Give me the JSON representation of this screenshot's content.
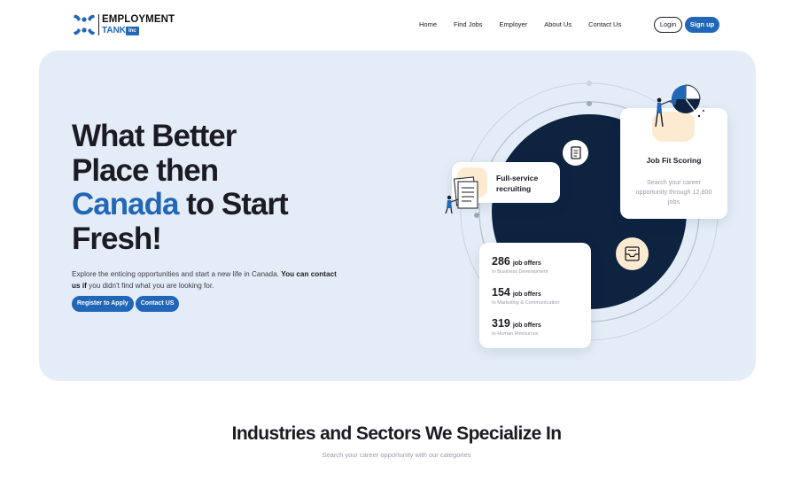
{
  "brand": {
    "name_line1": "EMPLOYMENT",
    "name_line2": "TANK",
    "badge": "Inc",
    "accent": "#2266b8",
    "dark": "#0d2340",
    "hero_bg": "#e4edf7",
    "peach": "#fcebd0"
  },
  "nav": {
    "items": [
      "Home",
      "Find Jobs",
      "Employer",
      "About Us",
      "Contact Us"
    ],
    "login_label": "Login",
    "signup_label": "Sign up"
  },
  "hero": {
    "title_line1": "What Better",
    "title_line2": "Place then",
    "title_highlight": "Canada",
    "title_line3_rest": " to Start",
    "title_line4": "Fresh!",
    "desc_plain": "Explore the enticing opportunities and start a new life in Canada. ",
    "desc_bold": "You can contact us if",
    "desc_rest": " you didn't find what you are looking for.",
    "register_label": "Register to Apply",
    "contact_label": "Contact US"
  },
  "illustration": {
    "full_service_label": "Full-service recruiting",
    "job_fit_title": "Job Fit Scoring",
    "job_fit_desc": "Search your career opportunity through 12,800 jobs",
    "jobs": [
      {
        "count": "286",
        "unit": "job offers",
        "category": "In Business Development"
      },
      {
        "count": "154",
        "unit": "job offers",
        "category": "In Marketing & Communication"
      },
      {
        "count": "319",
        "unit": "job offers",
        "category": "In Human Resources"
      }
    ],
    "icons": [
      "document-icon",
      "inbox-tray-icon",
      "pie-chart-icon",
      "person-icon"
    ]
  },
  "section": {
    "title": "Industries and Sectors We Specialize In",
    "subtitle": "Search your career opportunity with our categories"
  }
}
